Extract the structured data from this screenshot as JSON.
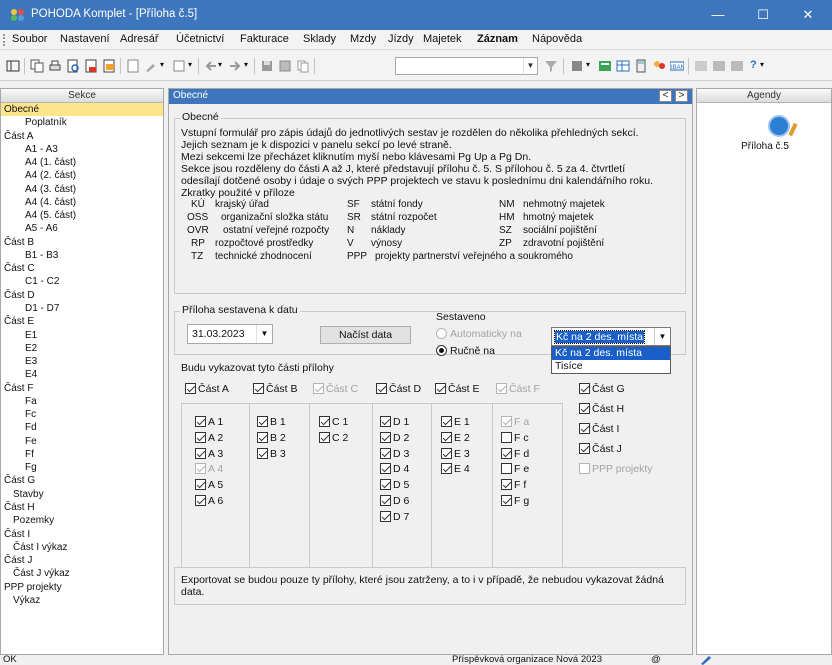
{
  "window": {
    "title": "POHODA Komplet - [Příloha č.5]",
    "minimize": "—",
    "maximize": "☐",
    "close": "✕"
  },
  "menu": [
    "Soubor",
    "Nastavení",
    "Adresář",
    "Účetnictví",
    "Fakturace",
    "Sklady",
    "Mzdy",
    "Jízdy",
    "Majetek",
    "Záznam",
    "Nápověda"
  ],
  "toolbar": {
    "help_label": "?"
  },
  "sekce": {
    "header": "Sekce",
    "items": [
      {
        "label": "Obecné",
        "level": 0,
        "selected": true
      },
      {
        "label": "Poplatník",
        "level": 2
      },
      {
        "label": "Část A",
        "level": 0
      },
      {
        "label": "A1 - A3",
        "level": 2
      },
      {
        "label": "A4 (1. část)",
        "level": 2
      },
      {
        "label": "A4 (2. část)",
        "level": 2
      },
      {
        "label": "A4 (3. část)",
        "level": 2
      },
      {
        "label": "A4 (4. část)",
        "level": 2
      },
      {
        "label": "A4 (5. část)",
        "level": 2
      },
      {
        "label": "A5 - A6",
        "level": 2
      },
      {
        "label": "Část B",
        "level": 0
      },
      {
        "label": "B1 - B3",
        "level": 2
      },
      {
        "label": "Část C",
        "level": 0
      },
      {
        "label": "C1 - C2",
        "level": 2
      },
      {
        "label": "Část D",
        "level": 0
      },
      {
        "label": "D1 - D7",
        "level": 2
      },
      {
        "label": "Část E",
        "level": 0
      },
      {
        "label": "E1",
        "level": 2
      },
      {
        "label": "E2",
        "level": 2
      },
      {
        "label": "E3",
        "level": 2
      },
      {
        "label": "E4",
        "level": 2
      },
      {
        "label": "Část F",
        "level": 0
      },
      {
        "label": "Fa",
        "level": 2
      },
      {
        "label": "Fc",
        "level": 2
      },
      {
        "label": "Fd",
        "level": 2
      },
      {
        "label": "Fe",
        "level": 2
      },
      {
        "label": "Ff",
        "level": 2
      },
      {
        "label": "Fg",
        "level": 2
      },
      {
        "label": "Část G",
        "level": 0
      },
      {
        "label": "Stavby",
        "level": 1
      },
      {
        "label": "Část H",
        "level": 0
      },
      {
        "label": "Pozemky",
        "level": 1
      },
      {
        "label": "Část I",
        "level": 0
      },
      {
        "label": "Část I výkaz",
        "level": 1
      },
      {
        "label": "Část J",
        "level": 0
      },
      {
        "label": "Část J výkaz",
        "level": 1
      },
      {
        "label": "PPP projekty",
        "level": 0
      },
      {
        "label": "Výkaz",
        "level": 1
      }
    ]
  },
  "main": {
    "header": "Obecné",
    "prev": "<",
    "next": ">",
    "general_title": "Obecné",
    "intro": [
      "Vstupní formulář pro zápis údajů do jednotlivých sestav je rozdělen do několika přehledných sekcí.",
      "Jejich seznam je k dispozici v panelu sekcí po levé straně.",
      "Mezi sekcemi lze přecházet kliknutím myší nebo klávesami Pg Up a Pg Dn.",
      "Sekce jsou rozděleny do části A až J, které představují přílohu č. 5. S přílohou č. 5 za 4. čtvrtletí",
      "odesílají dotčené osoby i údaje o svých PPP projektech ve stavu k poslednímu dni kalendářního roku."
    ],
    "abbr_title": "Zkratky použité v příloze",
    "abbr": [
      [
        {
          "a": "KÚ",
          "d": "krajský úřad"
        },
        {
          "a": "SF",
          "d": "státní fondy"
        },
        {
          "a": "NM",
          "d": "nehmotný majetek"
        }
      ],
      [
        {
          "a": "OSS",
          "d": "organizační složka státu"
        },
        {
          "a": "SR",
          "d": "státní rozpočet"
        },
        {
          "a": "HM",
          "d": "hmotný majetek"
        }
      ],
      [
        {
          "a": "OVR",
          "d": "ostatní veřejné rozpočty"
        },
        {
          "a": "N",
          "d": "náklady"
        },
        {
          "a": "SZ",
          "d": "sociální pojištění"
        }
      ],
      [
        {
          "a": "RP",
          "d": "rozpočtové prostředky"
        },
        {
          "a": "V",
          "d": "výnosy"
        },
        {
          "a": "ZP",
          "d": "zdravotní pojištění"
        }
      ],
      [
        {
          "a": "TZ",
          "d": "technické zhodnocení"
        },
        {
          "a": "PPP",
          "d": "projekty partnerství veřejného a soukromého"
        }
      ]
    ],
    "priloha_title": "Příloha sestavena k datu",
    "date_value": "31.03.2023",
    "load_button": "Načíst data",
    "sestaveno_label": "Sestaveno",
    "radio_auto": "Automaticky na",
    "radio_manual": "Ručně na",
    "unit_selected": "Kč na 2 des. místa",
    "unit_options": [
      "Kč na 2 des. místa",
      "Tisíce"
    ],
    "parts_title": "Budu vykazovat tyto části přílohy",
    "part_headers": [
      {
        "label": "Část A",
        "checked": true,
        "disabled": false
      },
      {
        "label": "Část B",
        "checked": true,
        "disabled": false
      },
      {
        "label": "Část C",
        "checked": true,
        "disabled": true
      },
      {
        "label": "Část D",
        "checked": true,
        "disabled": false
      },
      {
        "label": "Část E",
        "checked": true,
        "disabled": false
      },
      {
        "label": "Část F",
        "checked": true,
        "disabled": true
      }
    ],
    "columns": [
      [
        {
          "label": "A 1",
          "checked": true
        },
        {
          "label": "A 2",
          "checked": true
        },
        {
          "label": "A 3",
          "checked": true
        },
        {
          "label": "A 4",
          "checked": true,
          "disabled": true
        },
        {
          "label": "A 5",
          "checked": true
        },
        {
          "label": "A 6",
          "checked": true
        }
      ],
      [
        {
          "label": "B 1",
          "checked": true
        },
        {
          "label": "B 2",
          "checked": true
        },
        {
          "label": "B 3",
          "checked": true
        }
      ],
      [
        {
          "label": "C 1",
          "checked": true
        },
        {
          "label": "C 2",
          "checked": true
        }
      ],
      [
        {
          "label": "D 1",
          "checked": true
        },
        {
          "label": "D 2",
          "checked": true
        },
        {
          "label": "D 3",
          "checked": true
        },
        {
          "label": "D 4",
          "checked": true
        },
        {
          "label": "D 5",
          "checked": true
        },
        {
          "label": "D 6",
          "checked": true
        },
        {
          "label": "D 7",
          "checked": true
        }
      ],
      [
        {
          "label": "E 1",
          "checked": true
        },
        {
          "label": "E 2",
          "checked": true
        },
        {
          "label": "E 3",
          "checked": true
        },
        {
          "label": "E 4",
          "checked": true
        }
      ],
      [
        {
          "label": "F a",
          "checked": true,
          "disabled": true
        },
        {
          "label": "F c",
          "checked": false
        },
        {
          "label": "F d",
          "checked": true
        },
        {
          "label": "F e",
          "checked": false
        },
        {
          "label": "F f",
          "checked": true
        },
        {
          "label": "F g",
          "checked": true
        }
      ]
    ],
    "right_parts": [
      {
        "label": "Část G",
        "checked": true
      },
      {
        "label": "Část H",
        "checked": true
      },
      {
        "label": "Část I",
        "checked": true
      },
      {
        "label": "Část J",
        "checked": true
      },
      {
        "label": "PPP projekty",
        "checked": false,
        "disabled": true
      }
    ],
    "export_note": [
      "Exportovat se budou pouze ty přílohy, které jsou zatrženy, a to i v případě, že nebudou vykazovat žádná",
      "data."
    ]
  },
  "agendy": {
    "header": "Agendy",
    "item_label": "Příloha č.5"
  },
  "status": {
    "left": "OK",
    "center": "Příspěvková organizace Nová 2023",
    "icon1": "@"
  }
}
